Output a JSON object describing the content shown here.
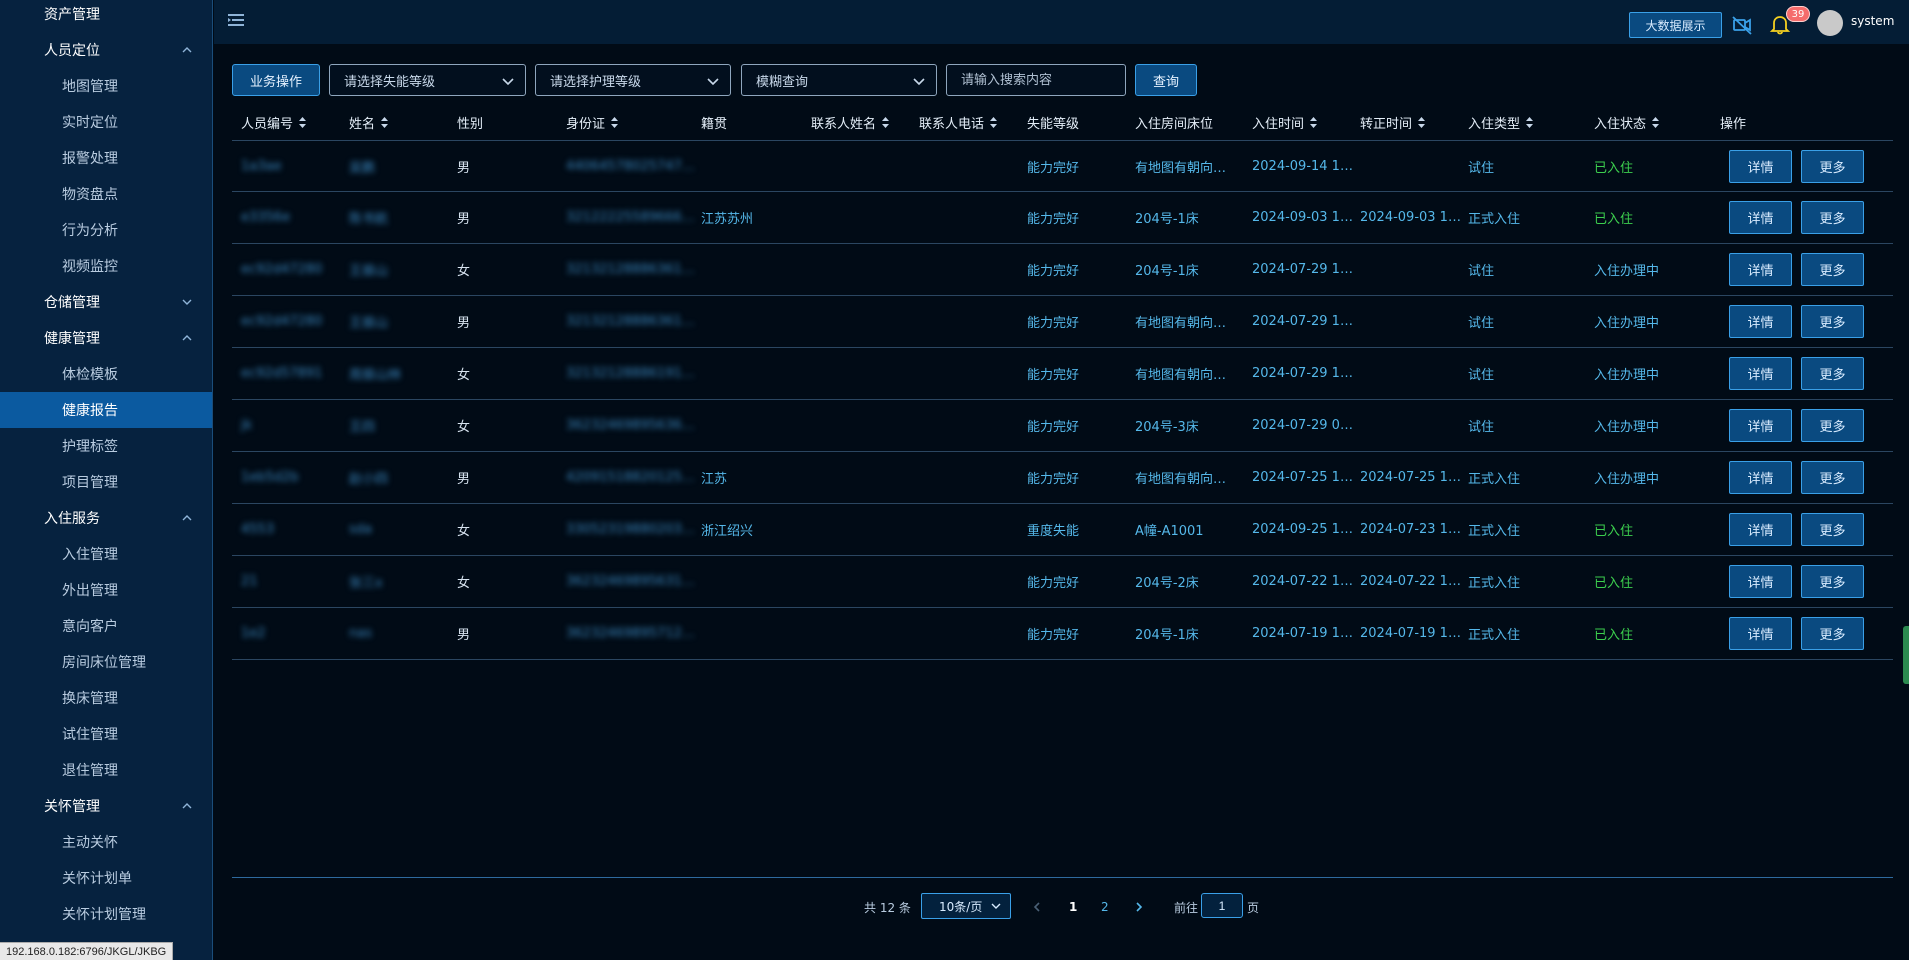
{
  "sidebar": {
    "items": [
      {
        "label": "资产管理",
        "kind": "group",
        "active": false,
        "chevron": "none"
      },
      {
        "label": "人员定位",
        "kind": "group",
        "active": false,
        "chevron": "up"
      },
      {
        "label": "地图管理",
        "kind": "sub",
        "active": false
      },
      {
        "label": "实时定位",
        "kind": "sub",
        "active": false
      },
      {
        "label": "报警处理",
        "kind": "sub",
        "active": false
      },
      {
        "label": "物资盘点",
        "kind": "sub",
        "active": false
      },
      {
        "label": "行为分析",
        "kind": "sub",
        "active": false
      },
      {
        "label": "视频监控",
        "kind": "sub",
        "active": false
      },
      {
        "label": "仓储管理",
        "kind": "group",
        "active": false,
        "chevron": "down"
      },
      {
        "label": "健康管理",
        "kind": "group",
        "active": false,
        "chevron": "up"
      },
      {
        "label": "体检模板",
        "kind": "sub",
        "active": false
      },
      {
        "label": "健康报告",
        "kind": "sub",
        "active": true
      },
      {
        "label": "护理标签",
        "kind": "sub",
        "active": false
      },
      {
        "label": "项目管理",
        "kind": "sub",
        "active": false
      },
      {
        "label": "入住服务",
        "kind": "group",
        "active": false,
        "chevron": "up"
      },
      {
        "label": "入住管理",
        "kind": "sub",
        "active": false
      },
      {
        "label": "外出管理",
        "kind": "sub",
        "active": false
      },
      {
        "label": "意向客户",
        "kind": "sub",
        "active": false
      },
      {
        "label": "房间床位管理",
        "kind": "sub",
        "active": false
      },
      {
        "label": "换床管理",
        "kind": "sub",
        "active": false
      },
      {
        "label": "试住管理",
        "kind": "sub",
        "active": false
      },
      {
        "label": "退住管理",
        "kind": "sub",
        "active": false
      },
      {
        "label": "关怀管理",
        "kind": "group",
        "active": false,
        "chevron": "up"
      },
      {
        "label": "主动关怀",
        "kind": "sub",
        "active": false
      },
      {
        "label": "关怀计划单",
        "kind": "sub",
        "active": false
      },
      {
        "label": "关怀计划管理",
        "kind": "sub",
        "active": false
      }
    ]
  },
  "statusbar": {
    "url": "192.168.0.182:6796/JKGL/JKBG"
  },
  "header": {
    "bigdata_label": "大数据展示",
    "notification_count": "39",
    "username": "system"
  },
  "toolbar": {
    "business_label": "业务操作",
    "disability_placeholder": "请选择失能等级",
    "nursing_placeholder": "请选择护理等级",
    "fuzzy_label": "模糊查询",
    "search_placeholder": "请输入搜索内容",
    "query_label": "查询"
  },
  "table": {
    "headers": [
      "人员编号",
      "姓名",
      "性别",
      "身份证",
      "籍贯",
      "联系人姓名",
      "联系人电话",
      "失能等级",
      "入住房间床位",
      "入住时间",
      "转正时间",
      "入住类型",
      "入住状态",
      "操作"
    ],
    "rows": [
      {
        "id": "1a3ae",
        "name": "吴鹏",
        "gender": "男",
        "idcard": "44064578025747…",
        "origin": "",
        "contact_name": "",
        "contact_phone": "",
        "disability": "能力完好",
        "room": "有地图有朝向…",
        "checkin": "2024-09-14 1…",
        "regular": "",
        "type": "试住",
        "status": "已入住",
        "status_kind": "in"
      },
      {
        "id": "e3356e",
        "name": "陈书航",
        "gender": "男",
        "idcard": "32122225589666…",
        "origin": "江苏苏州",
        "contact_name": "",
        "contact_phone": "",
        "disability": "能力完好",
        "room": "204号-1床",
        "checkin": "2024-09-03 1…",
        "regular": "2024-09-03 1…",
        "type": "正式入住",
        "status": "已入住",
        "status_kind": "in"
      },
      {
        "id": "ec92d47280",
        "name": "王振山",
        "gender": "女",
        "idcard": "32132128886361…",
        "origin": "",
        "contact_name": "",
        "contact_phone": "",
        "disability": "能力完好",
        "room": "204号-1床",
        "checkin": "2024-07-29 1…",
        "regular": "",
        "type": "试住",
        "status": "入住办理中",
        "status_kind": "pending"
      },
      {
        "id": "ec92d47280",
        "name": "王振山",
        "gender": "男",
        "idcard": "32132128886361…",
        "origin": "",
        "contact_name": "",
        "contact_phone": "",
        "disability": "能力完好",
        "room": "有地图有朝向…",
        "checkin": "2024-07-29 1…",
        "regular": "",
        "type": "试住",
        "status": "入住办理中",
        "status_kind": "pending"
      },
      {
        "id": "ec92d57891",
        "name": "周振山林",
        "gender": "女",
        "idcard": "32132128886191…",
        "origin": "",
        "contact_name": "",
        "contact_phone": "",
        "disability": "能力完好",
        "room": "有地图有朝向…",
        "checkin": "2024-07-29 1…",
        "regular": "",
        "type": "试住",
        "status": "入住办理中",
        "status_kind": "pending"
      },
      {
        "id": "jk",
        "name": "王四",
        "gender": "女",
        "idcard": "36232469895636…",
        "origin": "",
        "contact_name": "",
        "contact_phone": "",
        "disability": "能力完好",
        "room": "204号-3床",
        "checkin": "2024-07-29 0…",
        "regular": "",
        "type": "试住",
        "status": "入住办理中",
        "status_kind": "pending"
      },
      {
        "id": "1eb5d2b",
        "name": "赵小四",
        "gender": "男",
        "idcard": "42091518820125…",
        "origin": "江苏",
        "contact_name": "",
        "contact_phone": "",
        "disability": "能力完好",
        "room": "有地图有朝向…",
        "checkin": "2024-07-25 1…",
        "regular": "2024-07-25 1…",
        "type": "正式入住",
        "status": "入住办理中",
        "status_kind": "pending"
      },
      {
        "id": "4553",
        "name": "sda",
        "gender": "女",
        "idcard": "33052319880203…",
        "origin": "浙江绍兴",
        "contact_name": "",
        "contact_phone": "",
        "disability": "重度失能",
        "room": "A幢-A1001",
        "checkin": "2024-09-25 1…",
        "regular": "2024-07-23 1…",
        "type": "正式入住",
        "status": "已入住",
        "status_kind": "in"
      },
      {
        "id": "21",
        "name": "张三x",
        "gender": "女",
        "idcard": "36232469895631…",
        "origin": "",
        "contact_name": "",
        "contact_phone": "",
        "disability": "能力完好",
        "room": "204号-2床",
        "checkin": "2024-07-22 1…",
        "regular": "2024-07-22 1…",
        "type": "正式入住",
        "status": "已入住",
        "status_kind": "in"
      },
      {
        "id": "1e2",
        "name": "nas",
        "gender": "男",
        "idcard": "36232469895712…",
        "origin": "",
        "contact_name": "",
        "contact_phone": "",
        "disability": "能力完好",
        "room": "204号-1床",
        "checkin": "2024-07-19 1…",
        "regular": "2024-07-19 1…",
        "type": "正式入住",
        "status": "已入住",
        "status_kind": "in"
      }
    ],
    "detail_label": "详情",
    "more_label": "更多"
  },
  "pagination": {
    "total_text": "共 12 条",
    "page_size": "10条/页",
    "pages": [
      "1",
      "2"
    ],
    "current_page": "1",
    "goto_prefix": "前往",
    "goto_value": "1",
    "goto_suffix": "页"
  },
  "colors": {
    "accent": "#3aa0e8",
    "status_in": "#3ccf4e",
    "text_link": "#55b8ea",
    "active_nav": "#0b5aa0"
  }
}
